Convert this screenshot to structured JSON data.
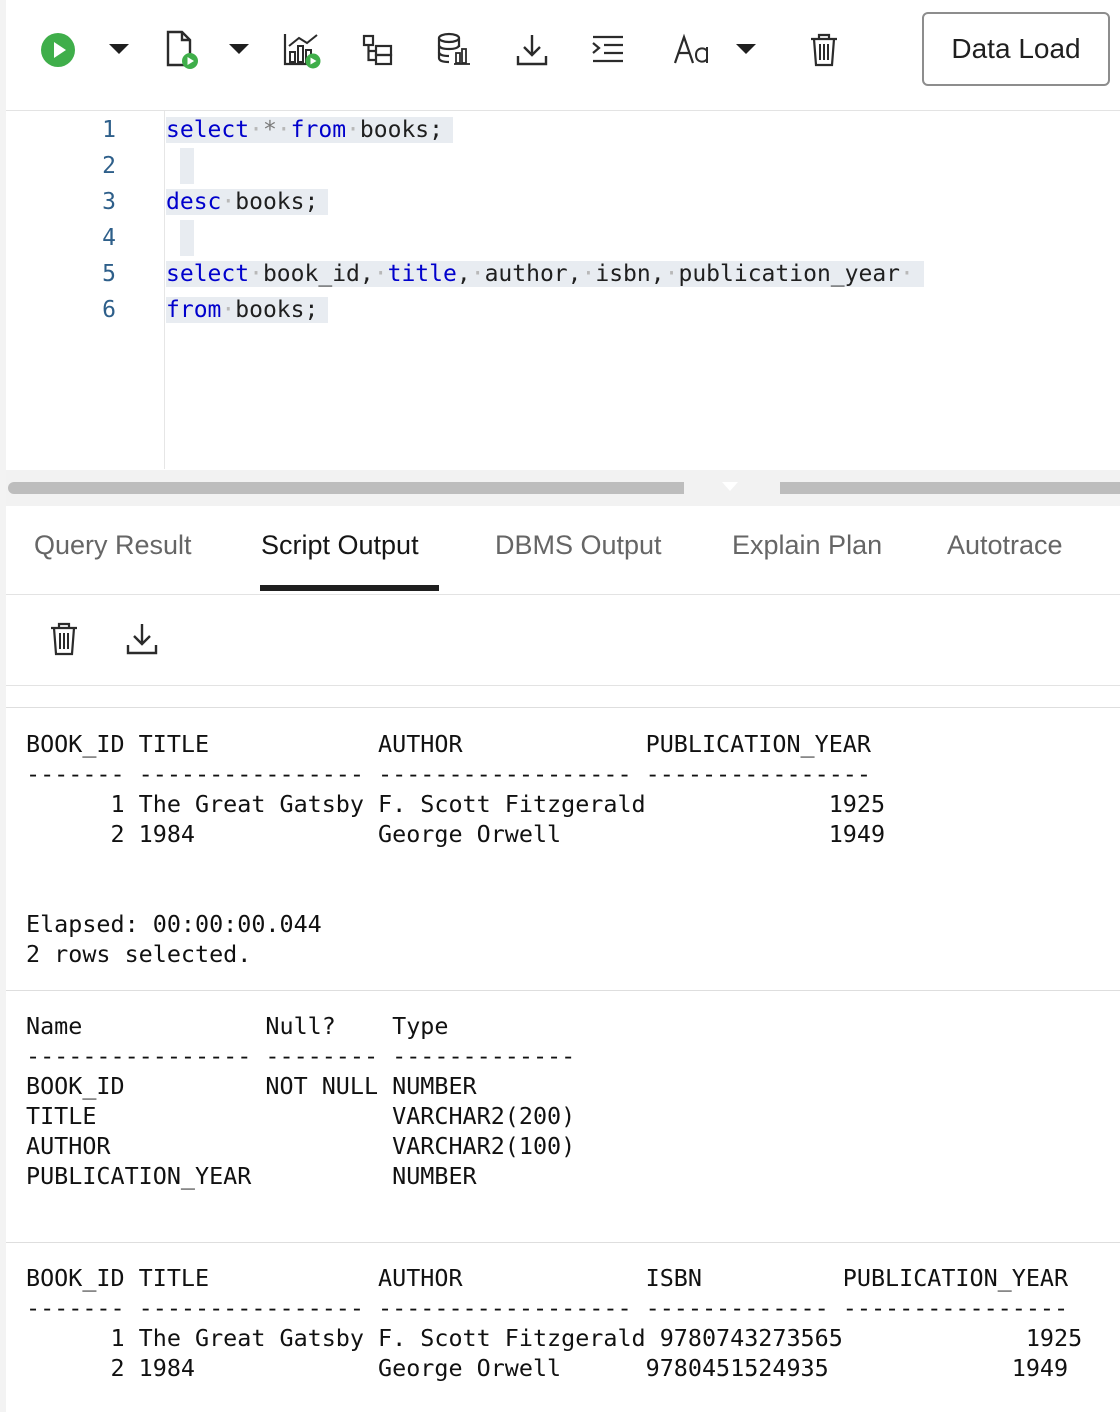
{
  "toolbar": {
    "icons": [
      "run-icon",
      "run-script-icon",
      "explain-plan-icon",
      "autotrace-icon",
      "sql-history-icon",
      "download-icon",
      "format-icon",
      "font-size-icon",
      "trash-icon"
    ],
    "data_load_label": "Data Load",
    "run_color": "#3fae4a"
  },
  "editor": {
    "line_numbers": [
      "1",
      "2",
      "3",
      "4",
      "5",
      "6"
    ],
    "lines": [
      [
        {
          "t": "select",
          "k": "kw"
        },
        {
          "t": "·",
          "k": "dot"
        },
        {
          "t": "*",
          "k": "sym"
        },
        {
          "t": "·",
          "k": "dot"
        },
        {
          "t": "from",
          "k": "kw"
        },
        {
          "t": "·",
          "k": "dot"
        },
        {
          "t": "books;",
          "k": ""
        }
      ],
      [],
      [
        {
          "t": "desc",
          "k": "kw"
        },
        {
          "t": "·",
          "k": "dot"
        },
        {
          "t": "books;",
          "k": ""
        }
      ],
      [],
      [
        {
          "t": "select",
          "k": "kw"
        },
        {
          "t": "·",
          "k": "dot"
        },
        {
          "t": "book_id,",
          "k": ""
        },
        {
          "t": "·",
          "k": "dot"
        },
        {
          "t": "title",
          "k": "kw"
        },
        {
          "t": ",",
          "k": ""
        },
        {
          "t": "·",
          "k": "dot"
        },
        {
          "t": "author,",
          "k": ""
        },
        {
          "t": "·",
          "k": "dot"
        },
        {
          "t": "isbn,",
          "k": ""
        },
        {
          "t": "·",
          "k": "dot"
        },
        {
          "t": "publication_year",
          "k": ""
        },
        {
          "t": "·",
          "k": "dot"
        }
      ],
      [
        {
          "t": "from",
          "k": "kw"
        },
        {
          "t": "·",
          "k": "dot"
        },
        {
          "t": "books;",
          "k": ""
        }
      ]
    ]
  },
  "tabs": [
    {
      "label": "Query Result",
      "active": false
    },
    {
      "label": "Script Output",
      "active": true
    },
    {
      "label": "DBMS Output",
      "active": false
    },
    {
      "label": "Explain Plan",
      "active": false
    },
    {
      "label": "Autotrace",
      "active": false
    }
  ],
  "output_toolbar": {
    "icons": [
      "trash-icon",
      "download-icon"
    ]
  },
  "output": {
    "block1": "BOOK_ID TITLE            AUTHOR             PUBLICATION_YEAR\n------- ---------------- ------------------ ----------------\n      1 The Great Gatsby F. Scott Fitzgerald             1925\n      2 1984             George Orwell                   1949",
    "block1_footer": "Elapsed: 00:00:00.044\n2 rows selected.",
    "block2": "Name             Null?    Type\n---------------- -------- -------------\nBOOK_ID          NOT NULL NUMBER\nTITLE                     VARCHAR2(200)\nAUTHOR                    VARCHAR2(100)\nPUBLICATION_YEAR          NUMBER",
    "block3": "BOOK_ID TITLE            AUTHOR             ISBN          PUBLICATION_YEAR\n------- ---------------- ------------------ ------------- ----------------\n      1 The Great Gatsby F. Scott Fitzgerald 9780743273565             1925\n      2 1984             George Orwell      9780451524935             1949"
  }
}
